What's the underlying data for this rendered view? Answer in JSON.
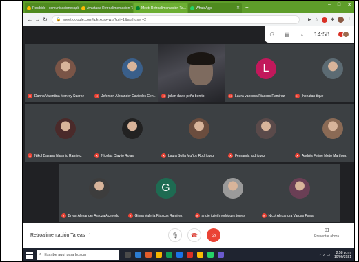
{
  "browser": {
    "tabs": [
      {
        "label": "Recibido - comunicacionesapb...",
        "favicon_color": "#fbbc04",
        "active": false
      },
      {
        "label": "Avastada Retroalimentación Ta...",
        "favicon_color": "#fbbc04",
        "active": false
      },
      {
        "label": "Meet: Retroalimentación Ta...",
        "favicon_color": "#00832d",
        "active": true
      },
      {
        "label": "WhatsApp",
        "favicon_color": "#25d366",
        "active": false
      }
    ],
    "new_tab": "+",
    "window_controls": [
      "–",
      "□",
      "✕"
    ],
    "url": "meet.google.com/tpk-xdsx-wzr?pli=1&authuser=2"
  },
  "meet": {
    "info_bar": {
      "clock": "14:58"
    },
    "participants": [
      {
        "name": "Danna Valentina Monroy Suarez",
        "type": "photo",
        "color": "#7a5547"
      },
      {
        "name": "Jeferson Alexander Caviedes Cen...",
        "type": "photo",
        "color": "#3a5f8a"
      },
      {
        "name": "julian david peña benito",
        "type": "video",
        "color": "#7e6b5f"
      },
      {
        "name": "Laura vanessa Riascos Ramirez",
        "type": "letter",
        "letter": "L",
        "color": "#c2185b"
      },
      {
        "name": "jhonatan tique",
        "type": "photo",
        "color": "#5c6b73"
      },
      {
        "name": "Nikol Dayana Naranjo Ramirez",
        "type": "photo",
        "color": "#4a2a2a"
      },
      {
        "name": "Nicolás Clavijo Rojas",
        "type": "photo",
        "color": "#222222"
      },
      {
        "name": "Laura Sofía Muñoz Rodríguez",
        "type": "photo",
        "color": "#6b4d3e"
      },
      {
        "name": "Fernanda rodriguez",
        "type": "photo",
        "color": "#5a4a4a"
      },
      {
        "name": "Andrés Felipe Nieto Martínez",
        "type": "photo",
        "color": "#8a6a55"
      },
      {
        "name": "Bryan Alexander Araoza Acevedo",
        "type": "photo",
        "color": "#3d3d3d"
      },
      {
        "name": "Ginna Valeria Riascos Ramirez",
        "type": "letter",
        "letter": "G",
        "color": "#1e6b52"
      },
      {
        "name": "angie julieth rodriguez torres",
        "type": "photo",
        "color": "#9a9a9a"
      },
      {
        "name": "Nicol Alexandra Vargas Parra",
        "type": "photo",
        "color": "#6a3f55"
      }
    ],
    "bottom": {
      "meeting_title": "Retroalimentación Tareas",
      "present_label": "Presentar ahora"
    }
  },
  "taskbar": {
    "search_placeholder": "Escribe aquí para buscar",
    "time": "2:58 p. m.",
    "date": "10/06/2021",
    "app_colors": [
      "#4a4a4a",
      "#2b7cd3",
      "#e25c2a",
      "#f4b400",
      "#0f9d58",
      "#1a73e8",
      "#d93025",
      "#fbbc04",
      "#25d366",
      "#6a5acd"
    ]
  },
  "colors": {
    "meet_bg": "#202124",
    "tile_bg": "#3c4043",
    "mic_off": "#ea4335",
    "tab_strip": "#5e9d2a"
  }
}
